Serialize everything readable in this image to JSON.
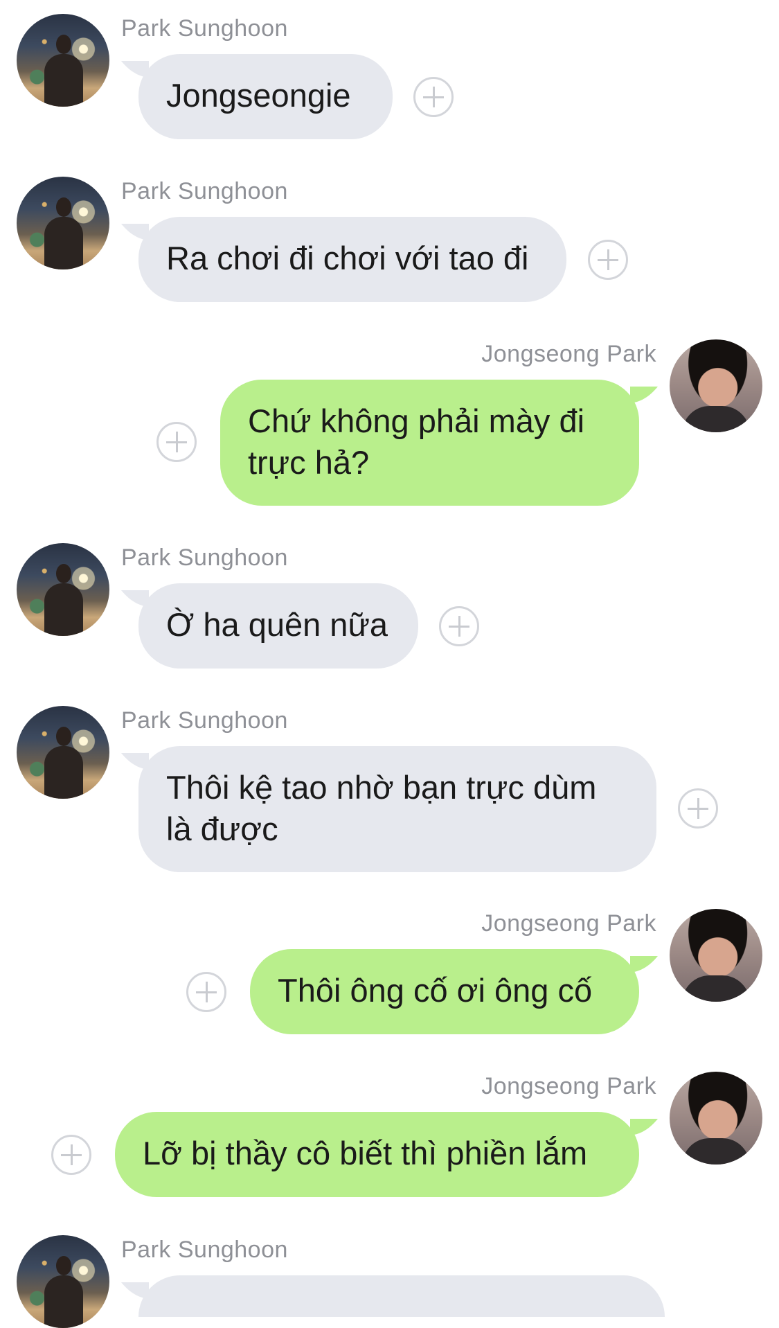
{
  "colors": {
    "incoming_bubble": "#e6e8ee",
    "outgoing_bubble": "#b9ef8c",
    "name_text": "#8e9096",
    "plus_icon": "#d3d5da"
  },
  "messages": [
    {
      "sender": "Park Sunghoon",
      "direction": "incoming",
      "lines": [
        "Jongseongie"
      ]
    },
    {
      "sender": "Park Sunghoon",
      "direction": "incoming",
      "lines": [
        "Ra chơi đi chơi với tao đi"
      ]
    },
    {
      "sender": "Jongseong Park",
      "direction": "outgoing",
      "lines": [
        "Chứ không phải mày đi",
        "trực hả?"
      ]
    },
    {
      "sender": "Park Sunghoon",
      "direction": "incoming",
      "lines": [
        "Ờ ha quên nữa"
      ]
    },
    {
      "sender": "Park Sunghoon",
      "direction": "incoming",
      "lines": [
        "Thôi kệ tao nhờ bạn trực dùm",
        "là được"
      ]
    },
    {
      "sender": "Jongseong Park",
      "direction": "outgoing",
      "lines": [
        "Thôi ông cố ơi ông cố"
      ]
    },
    {
      "sender": "Jongseong Park",
      "direction": "outgoing",
      "lines": [
        "Lỡ bị thầy cô biết thì phiền lắm"
      ]
    },
    {
      "sender": "Park Sunghoon",
      "direction": "incoming",
      "lines": []
    }
  ]
}
